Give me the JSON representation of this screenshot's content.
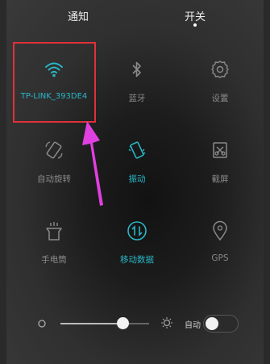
{
  "header": {
    "tabs": [
      {
        "label": "通知",
        "selected": false
      },
      {
        "label": "开关",
        "selected": true
      }
    ]
  },
  "tiles": [
    {
      "label": "TP-LINK_393DE4",
      "icon": "wifi-icon",
      "active": true
    },
    {
      "label": "蓝牙",
      "icon": "bluetooth-icon",
      "active": false
    },
    {
      "label": "设置",
      "icon": "settings-gear-icon",
      "active": false
    },
    {
      "label": "自动旋转",
      "icon": "auto-rotate-icon",
      "active": false
    },
    {
      "label": "振动",
      "icon": "vibrate-icon",
      "active": true
    },
    {
      "label": "截屏",
      "icon": "screenshot-icon",
      "active": false
    },
    {
      "label": "手电筒",
      "icon": "flashlight-icon",
      "active": false
    },
    {
      "label": "移动数据",
      "icon": "mobile-data-icon",
      "active": true
    },
    {
      "label": "GPS",
      "icon": "gps-icon",
      "active": false
    }
  ],
  "brightness": {
    "level": 0.7,
    "auto_label": "自动",
    "auto_enabled": false
  },
  "colors": {
    "accent": "#29b6c6",
    "inactive_icon": "#8a8a8a",
    "annotation_red": "#e0303a",
    "annotation_arrow": "#e040e0"
  }
}
